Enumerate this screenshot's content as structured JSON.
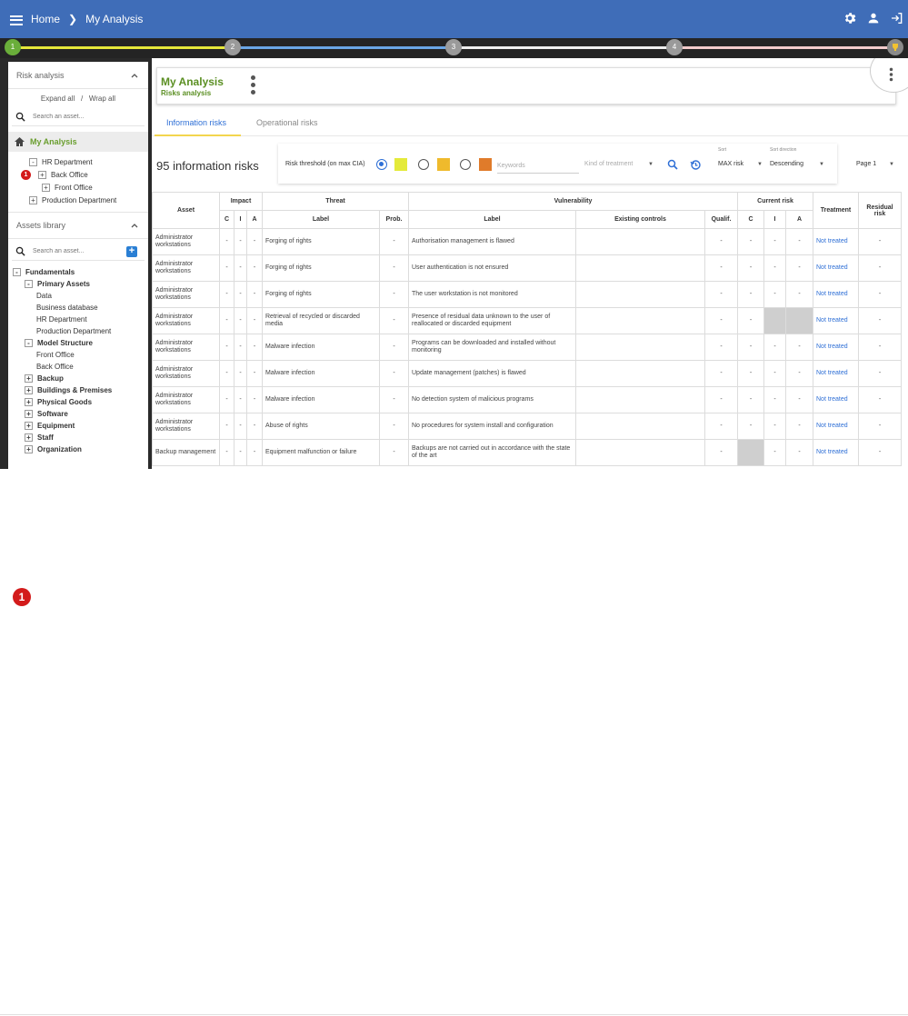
{
  "header": {
    "breadcrumb": [
      "Home",
      "My Analysis"
    ],
    "icons": [
      "settings-icon",
      "account-icon",
      "logout-icon"
    ]
  },
  "stepper": {
    "steps": [
      "1",
      "2",
      "3",
      "4",
      ""
    ],
    "colors": [
      "#e6e83a",
      "#6aa6e6",
      "#eeeeee",
      "#f3cccc"
    ]
  },
  "sidebar": {
    "risk_analysis_title": "Risk analysis",
    "expand_all": "Expand all",
    "separator": "/",
    "wrap_all": "Wrap all",
    "search_placeholder": "Search an asset...",
    "root": "My Analysis",
    "tree": [
      {
        "label": "HR Department",
        "toggle": "-"
      },
      {
        "label": "Back Office",
        "toggle": "+"
      },
      {
        "label": "Front Office",
        "toggle": "+"
      },
      {
        "label": "Production Department",
        "toggle": "+"
      }
    ],
    "badge": "1",
    "library_title": "Assets library",
    "library_search_placeholder": "Search an asset...",
    "library": [
      {
        "label": "Fundamentals",
        "toggle": "-",
        "bold": true
      },
      {
        "label": "Primary Assets",
        "toggle": "-",
        "bold": true
      },
      {
        "label": "Data"
      },
      {
        "label": "Business database"
      },
      {
        "label": "HR Department"
      },
      {
        "label": "Production Department"
      },
      {
        "label": "Model Structure",
        "toggle": "-",
        "bold": true
      },
      {
        "label": "Front Office"
      },
      {
        "label": "Back Office"
      },
      {
        "label": "Backup",
        "toggle": "+",
        "bold": true
      },
      {
        "label": "Buildings & Premises",
        "toggle": "+",
        "bold": true
      },
      {
        "label": "Physical Goods",
        "toggle": "+",
        "bold": true
      },
      {
        "label": "Software",
        "toggle": "+",
        "bold": true
      },
      {
        "label": "Equipment",
        "toggle": "+",
        "bold": true
      },
      {
        "label": "Staff",
        "toggle": "+",
        "bold": true
      },
      {
        "label": "Organization",
        "toggle": "+",
        "bold": true
      }
    ]
  },
  "main": {
    "title": "My Analysis",
    "subtitle": "Risks analysis",
    "tabs": [
      "Information risks",
      "Operational risks"
    ],
    "count_label": "95 information risks",
    "filters": {
      "threshold_label": "Risk threshold (on max CIA)",
      "swatch_colors": [
        "#e4ea3a",
        "#efba2c",
        "#e07b2a"
      ],
      "keywords_placeholder": "Keywords",
      "treatment_placeholder": "Kind of treatment",
      "sort_label": "Sort",
      "sort_value": "MAX risk",
      "direction_label": "Sort direction",
      "direction_value": "Descending",
      "page_value": "Page 1"
    },
    "table": {
      "group_headers": [
        "Asset",
        "Impact",
        "Threat",
        "Vulnerability",
        "Current risk",
        "Treatment",
        "Residual risk"
      ],
      "sub_headers": [
        "C",
        "I",
        "A",
        "Label",
        "Prob.",
        "Label",
        "Existing controls",
        "Qualif.",
        "C",
        "I",
        "A"
      ],
      "rows": [
        {
          "asset": "Administrator workstations",
          "c": "-",
          "i": "-",
          "a": "-",
          "threat": "Forging of rights",
          "prob": "-",
          "vuln": "Authorisation management is flawed",
          "controls": "",
          "qualif": "-",
          "rc": "-",
          "ri": "-",
          "ra": "-",
          "treatment": "Not treated",
          "residual": "-",
          "gray": []
        },
        {
          "asset": "Administrator workstations",
          "c": "-",
          "i": "-",
          "a": "-",
          "threat": "Forging of rights",
          "prob": "-",
          "vuln": "User authentication is not ensured",
          "controls": "",
          "qualif": "-",
          "rc": "-",
          "ri": "-",
          "ra": "-",
          "treatment": "Not treated",
          "residual": "-",
          "gray": []
        },
        {
          "asset": "Administrator workstations",
          "c": "-",
          "i": "-",
          "a": "-",
          "threat": "Forging of rights",
          "prob": "-",
          "vuln": "The user workstation is not monitored",
          "controls": "",
          "qualif": "-",
          "rc": "-",
          "ri": "-",
          "ra": "-",
          "treatment": "Not treated",
          "residual": "-",
          "gray": []
        },
        {
          "asset": "Administrator workstations",
          "c": "-",
          "i": "-",
          "a": "-",
          "threat": "Retrieval of recycled or discarded media",
          "prob": "-",
          "vuln": "Presence of residual data unknown to the user of reallocated or discarded equipment",
          "controls": "",
          "qualif": "-",
          "rc": "-",
          "ri": "",
          "ra": "",
          "treatment": "Not treated",
          "residual": "-",
          "gray": [
            "ri",
            "ra"
          ]
        },
        {
          "asset": "Administrator workstations",
          "c": "-",
          "i": "-",
          "a": "-",
          "threat": "Malware infection",
          "prob": "-",
          "vuln": "Programs can be downloaded and installed without monitoring",
          "controls": "",
          "qualif": "-",
          "rc": "-",
          "ri": "-",
          "ra": "-",
          "treatment": "Not treated",
          "residual": "-",
          "gray": []
        },
        {
          "asset": "Administrator workstations",
          "c": "-",
          "i": "-",
          "a": "-",
          "threat": "Malware infection",
          "prob": "-",
          "vuln": "Update management (patches) is flawed",
          "controls": "",
          "qualif": "-",
          "rc": "-",
          "ri": "-",
          "ra": "-",
          "treatment": "Not treated",
          "residual": "-",
          "gray": []
        },
        {
          "asset": "Administrator workstations",
          "c": "-",
          "i": "-",
          "a": "-",
          "threat": "Malware infection",
          "prob": "-",
          "vuln": "No detection system of malicious programs",
          "controls": "",
          "qualif": "-",
          "rc": "-",
          "ri": "-",
          "ra": "-",
          "treatment": "Not treated",
          "residual": "-",
          "gray": []
        },
        {
          "asset": "Administrator workstations",
          "c": "-",
          "i": "-",
          "a": "-",
          "threat": "Abuse of rights",
          "prob": "-",
          "vuln": "No procedures for system install and configuration",
          "controls": "",
          "qualif": "-",
          "rc": "-",
          "ri": "-",
          "ra": "-",
          "treatment": "Not treated",
          "residual": "-",
          "gray": []
        },
        {
          "asset": "Backup management",
          "c": "-",
          "i": "-",
          "a": "-",
          "threat": "Equipment malfunction or failure",
          "prob": "-",
          "vuln": "Backups are not carried out in accordance with the state of the art",
          "controls": "",
          "qualif": "-",
          "rc": "",
          "ri": "-",
          "ra": "-",
          "treatment": "Not treated",
          "residual": "-",
          "gray": [
            "rc"
          ]
        }
      ]
    }
  },
  "overlay": {
    "badge": "1"
  }
}
